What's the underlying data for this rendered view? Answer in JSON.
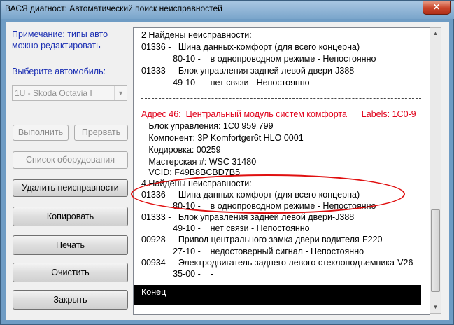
{
  "window": {
    "title": "ВАСЯ диагност: Автоматический поиск неисправностей",
    "close": "✕"
  },
  "left": {
    "note": "Примечание: типы авто можно редактировать",
    "select_label": "Выберите автомобиль:",
    "car_select_value": "1U - Skoda Octavia I",
    "buttons": {
      "run": "Выполнить",
      "stop": "Прервать",
      "equipment": "Список оборудования",
      "delete": "Удалить неисправности",
      "copy": "Копировать",
      "print": "Печать",
      "clear": "Очистить",
      "close": "Закрыть"
    }
  },
  "log": {
    "lines": [
      "2 Найдены неисправности:",
      "01336 -   Шина данных-комфорт (для всего концерна)",
      "             80-10 -    в однопроводном режиме - Непостоянно",
      "01333 -   Блок управления задней левой двери-J388",
      "             49-10 -    нет связи - Непостоянно",
      "Адрес 46:  Центральный модуль систем комфорта      Labels: 1C0-9",
      "   Блок управления: 1C0 959 799",
      "   Компонент: 3P Komfortger6t HLO 0001",
      "   Кодировка: 00259",
      "   Мастерская #: WSC 31480",
      "   VCID: F49B8BCBD7B5",
      "4 Найдены неисправности:",
      "01336 -   Шина данных-комфорт (для всего концерна)",
      "             80-10 -    в однопроводном режиме - Непостоянно",
      "01333 -   Блок управления задней левой двери-J388",
      "             49-10 -    нет связи - Непостоянно",
      "00928 -   Привод центрального замка двери водителя-F220",
      "             27-10 -    недостоверный сигнал - Непостоянно",
      "00934 -   Электродвигатель заднего левого стеклоподъемника-V26",
      "             35-00 -    -",
      "Конец"
    ]
  },
  "colors": {
    "accent_red": "#e0001a",
    "label_blue": "#1b2fb3"
  },
  "icons": {
    "scroll_up": "▲",
    "scroll_down": "▼",
    "dropdown": "▼"
  }
}
